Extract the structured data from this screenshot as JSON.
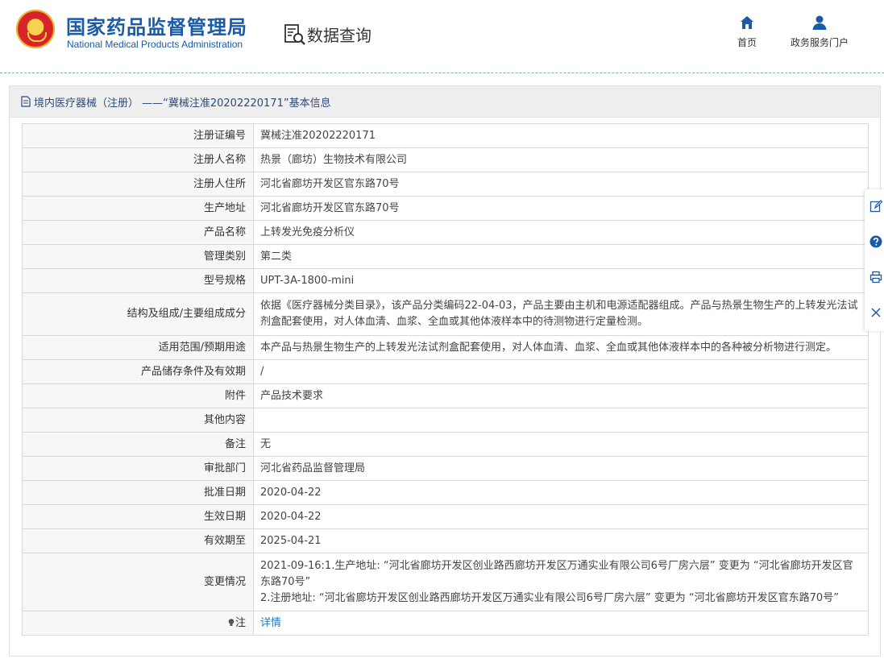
{
  "header": {
    "title_cn": "国家药品监督管理局",
    "title_en": "National Medical Products Administration",
    "query_label": "数据查询",
    "nav": [
      {
        "label": "首页",
        "icon": "home-icon"
      },
      {
        "label": "政务服务门户",
        "icon": "user-icon"
      }
    ]
  },
  "panel": {
    "heading": "境内医疗器械（注册） ——“冀械注准20202220171”基本信息"
  },
  "rows": [
    {
      "label": "注册证编号",
      "value": "冀械注准20202220171"
    },
    {
      "label": "注册人名称",
      "value": "热景（廊坊）生物技术有限公司"
    },
    {
      "label": "注册人住所",
      "value": "河北省廊坊开发区官东路70号"
    },
    {
      "label": "生产地址",
      "value": "河北省廊坊开发区官东路70号"
    },
    {
      "label": "产品名称",
      "value": "上转发光免疫分析仪"
    },
    {
      "label": "管理类别",
      "value": "第二类"
    },
    {
      "label": "型号规格",
      "value": "UPT-3A-1800-mini"
    },
    {
      "label": "结构及组成/主要组成成分",
      "value": "依据《医疗器械分类目录》，该产品分类编码22-04-03，产品主要由主机和电源适配器组成。产品与热景生物生产的上转发光法试剂盒配套使用，对人体血清、血浆、全血或其他体液样本中的待测物进行定量检测。"
    },
    {
      "label": "适用范围/预期用途",
      "value": "本产品与热景生物生产的上转发光法试剂盒配套使用，对人体血清、血浆、全血或其他体液样本中的各种被分析物进行测定。"
    },
    {
      "label": "产品储存条件及有效期",
      "value": "/"
    },
    {
      "label": "附件",
      "value": "产品技术要求"
    },
    {
      "label": "其他内容",
      "value": ""
    },
    {
      "label": "备注",
      "value": "无"
    },
    {
      "label": "审批部门",
      "value": "河北省药品监督管理局"
    },
    {
      "label": "批准日期",
      "value": "2020-04-22"
    },
    {
      "label": "生效日期",
      "value": "2020-04-22"
    },
    {
      "label": "有效期至",
      "value": "2025-04-21"
    },
    {
      "label": "变更情况",
      "value_line1": "2021-09-16:1.生产地址: “河北省廊坊开发区创业路西廊坊开发区万通实业有限公司6号厂房六层” 变更为 “河北省廊坊开发区官东路70号”",
      "value_line2": "2.注册地址: “河北省廊坊开发区创业路西廊坊开发区万通实业有限公司6号厂房六层” 变更为 “河北省廊坊开发区官东路70号”"
    },
    {
      "label": "注",
      "value": "详情"
    }
  ],
  "side_tools": [
    {
      "icon": "edit-icon"
    },
    {
      "icon": "help-icon"
    },
    {
      "icon": "print-icon"
    },
    {
      "icon": "close-icon"
    }
  ],
  "colors": {
    "brand_blue": "#1a5aa6",
    "link_blue": "#1a7bd1",
    "label_bg": "#f7f7f7",
    "border": "#d9d9d9"
  }
}
